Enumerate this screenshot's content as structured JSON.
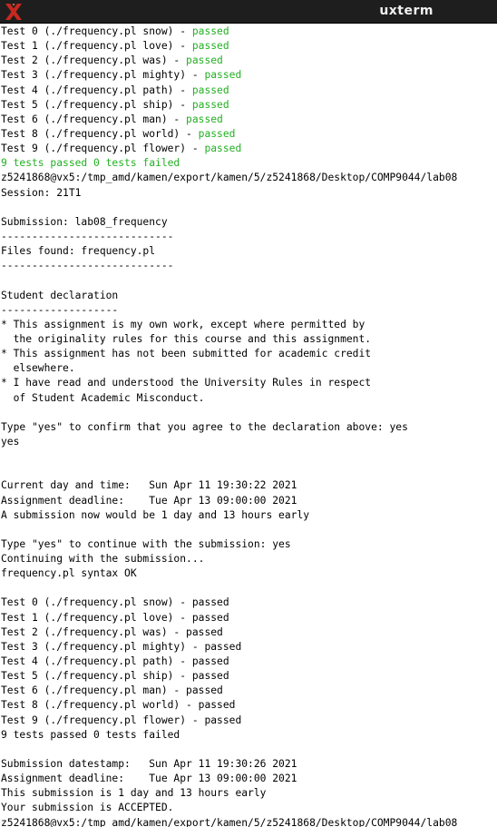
{
  "window": {
    "title": "uxterm",
    "icon": "x-logo-icon",
    "colors": {
      "title_bg": "#1e1e1e",
      "title_text": "#f0f0f0",
      "pass_green": "#22b022",
      "logo_red": "#c8281e"
    }
  },
  "terminal": {
    "lines": [
      {
        "text": "Test 0 (./frequency.pl snow) - ",
        "status": "passed",
        "green": true
      },
      {
        "text": "Test 1 (./frequency.pl love) - ",
        "status": "passed",
        "green": true
      },
      {
        "text": "Test 2 (./frequency.pl was) - ",
        "status": "passed",
        "green": true
      },
      {
        "text": "Test 3 (./frequency.pl mighty) - ",
        "status": "passed",
        "green": true
      },
      {
        "text": "Test 4 (./frequency.pl path) - ",
        "status": "passed",
        "green": true
      },
      {
        "text": "Test 5 (./frequency.pl ship) - ",
        "status": "passed",
        "green": true
      },
      {
        "text": "Test 6 (./frequency.pl man) - ",
        "status": "passed",
        "green": true
      },
      {
        "text": "Test 8 (./frequency.pl world) - ",
        "status": "passed",
        "green": true
      },
      {
        "text": "Test 9 (./frequency.pl flower) - ",
        "status": "passed",
        "green": true
      },
      {
        "text": "9 tests passed 0 tests failed",
        "all_green": true
      },
      {
        "text": "z5241868@vx5:/tmp_amd/kamen/export/kamen/5/z5241868/Desktop/COMP9044/lab08"
      },
      {
        "text": "Session: 21T1"
      },
      {
        "text": ""
      },
      {
        "text": "Submission: lab08_frequency"
      },
      {
        "text": "----------------------------"
      },
      {
        "text": "Files found: frequency.pl"
      },
      {
        "text": "----------------------------"
      },
      {
        "text": ""
      },
      {
        "text": "Student declaration"
      },
      {
        "text": "-------------------"
      },
      {
        "text": "* This assignment is my own work, except where permitted by"
      },
      {
        "text": "  the originality rules for this course and this assignment."
      },
      {
        "text": "* This assignment has not been submitted for academic credit"
      },
      {
        "text": "  elsewhere."
      },
      {
        "text": "* I have read and understood the University Rules in respect"
      },
      {
        "text": "  of Student Academic Misconduct."
      },
      {
        "text": ""
      },
      {
        "text": "Type \"yes\" to confirm that you agree to the declaration above: yes"
      },
      {
        "text": "yes"
      },
      {
        "text": ""
      },
      {
        "text": ""
      },
      {
        "text": "Current day and time:   Sun Apr 11 19:30:22 2021"
      },
      {
        "text": "Assignment deadline:    Tue Apr 13 09:00:00 2021"
      },
      {
        "text": "A submission now would be 1 day and 13 hours early"
      },
      {
        "text": ""
      },
      {
        "text": "Type \"yes\" to continue with the submission: yes"
      },
      {
        "text": "Continuing with the submission..."
      },
      {
        "text": "frequency.pl syntax OK"
      },
      {
        "text": ""
      },
      {
        "text": "Test 0 (./frequency.pl snow) - passed"
      },
      {
        "text": "Test 1 (./frequency.pl love) - passed"
      },
      {
        "text": "Test 2 (./frequency.pl was) - passed"
      },
      {
        "text": "Test 3 (./frequency.pl mighty) - passed"
      },
      {
        "text": "Test 4 (./frequency.pl path) - passed"
      },
      {
        "text": "Test 5 (./frequency.pl ship) - passed"
      },
      {
        "text": "Test 6 (./frequency.pl man) - passed"
      },
      {
        "text": "Test 8 (./frequency.pl world) - passed"
      },
      {
        "text": "Test 9 (./frequency.pl flower) - passed"
      },
      {
        "text": "9 tests passed 0 tests failed"
      },
      {
        "text": ""
      },
      {
        "text": "Submission datestamp:   Sun Apr 11 19:30:26 2021"
      },
      {
        "text": "Assignment deadline:    Tue Apr 13 09:00:00 2021"
      },
      {
        "text": "This submission is 1 day and 13 hours early"
      },
      {
        "text": "Your submission is ACCEPTED."
      },
      {
        "text": "z5241868@vx5:/tmp_amd/kamen/export/kamen/5/z5241868/Desktop/COMP9044/lab08"
      }
    ]
  }
}
